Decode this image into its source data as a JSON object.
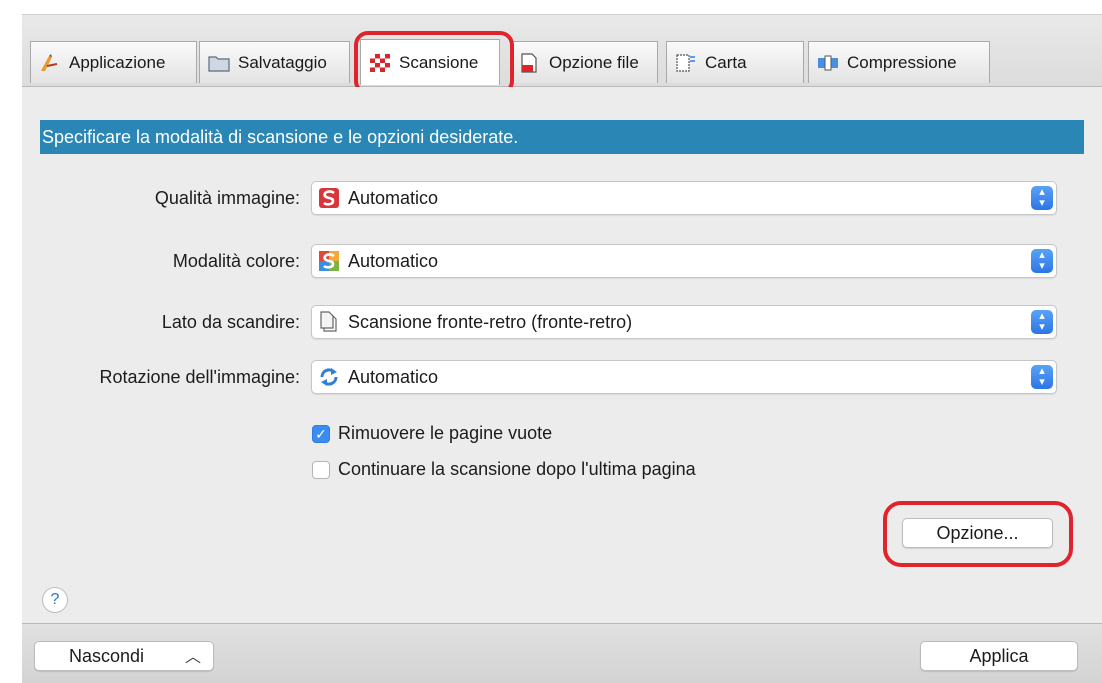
{
  "tabs": [
    {
      "label": "Applicazione",
      "icon": "pen-icon"
    },
    {
      "label": "Salvataggio",
      "icon": "folder-icon"
    },
    {
      "label": "Scansione",
      "icon": "checkered-scan-icon",
      "active": true
    },
    {
      "label": "Opzione file",
      "icon": "file-icon"
    },
    {
      "label": "Carta",
      "icon": "paper-size-icon"
    },
    {
      "label": "Compressione",
      "icon": "compression-icon"
    }
  ],
  "banner": "Specificare la modalità di scansione e le opzioni desiderate.",
  "fields": [
    {
      "label": "Qualità immagine:",
      "value": "Automatico",
      "icon": "image-quality-icon"
    },
    {
      "label": "Modalità colore:",
      "value": "Automatico",
      "icon": "color-mode-icon"
    },
    {
      "label": "Lato da scandire:",
      "value": "Scansione fronte-retro (fronte-retro)",
      "icon": "document-icon"
    },
    {
      "label": "Rotazione dell'immagine:",
      "value": "Automatico",
      "icon": "rotate-icon"
    }
  ],
  "checkboxes": [
    {
      "label": "Rimuovere le pagine vuote",
      "checked": true
    },
    {
      "label": "Continuare la scansione dopo l'ultima pagina",
      "checked": false
    }
  ],
  "buttons": {
    "option": "Opzione...",
    "hide": "Nascondi",
    "hide_chevron": "^",
    "apply": "Applica",
    "help": "?"
  },
  "highlight_color": "#e0242c",
  "banner_color": "#2a86b5"
}
